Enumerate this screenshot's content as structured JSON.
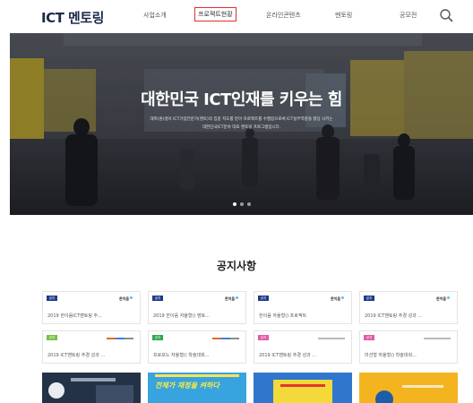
{
  "header": {
    "logo": "ICT 멘토링",
    "nav": [
      "사업소개",
      "프로젝트현황",
      "온라인콘텐츠",
      "멘토링",
      "공모전"
    ],
    "active_index": 1
  },
  "hero": {
    "title": "대한민국 ICT인재를 키우는 힘",
    "subtitle_line1": "대학(원)생이 ICT기업전문가(멘토)의 집중 지도를 받아 프로젝트를 수행함으로써 ICT실무역량을 향상 시키는",
    "subtitle_line2": "대한민국ICT분야 대표 멘토링 프로그램입니다.",
    "slide_count": 3,
    "active_slide": 1
  },
  "notice": {
    "title": "공지사항",
    "cards": [
      {
        "badge": "공지",
        "badge_color": "#1f3a8a",
        "logo": "한이음",
        "caption": "2019 한이음ICT멘토링 추..."
      },
      {
        "badge": "공지",
        "badge_color": "#1f3a8a",
        "logo": "한이음",
        "caption": "2019 한이음 자율형() 멘토..."
      },
      {
        "badge": "공지",
        "badge_color": "#1f3a8a",
        "logo": "한이음",
        "caption": "한이음 자율형() 프로젝트"
      },
      {
        "badge": "공지",
        "badge_color": "#1f3a8a",
        "logo": "한이음",
        "caption": "2019 ICT멘토링 추경 성과 ..."
      },
      {
        "badge": "공지",
        "badge_color": "#7ac043",
        "logo": "",
        "caption": "2019 ICT멘토링 추경 성과 ..."
      },
      {
        "badge": "공지",
        "badge_color": "#2fa84f",
        "logo": "",
        "caption": "프로보노 자율형() 학술대회..."
      },
      {
        "badge": "공지",
        "badge_color": "#e05aa6",
        "logo": "",
        "caption": "2019 ICT멘토링 추경 성과 ..."
      },
      {
        "badge": "공지",
        "badge_color": "#e05aa6",
        "logo": "",
        "caption": "미션형 자율형() 학술대회..."
      }
    ],
    "thumb_text": "전체가 재정을 켜하다"
  },
  "colors": {
    "logo": "#1b2a4a",
    "active_nav_border": "#e23030",
    "badge_navy": "#1f3a8a"
  }
}
